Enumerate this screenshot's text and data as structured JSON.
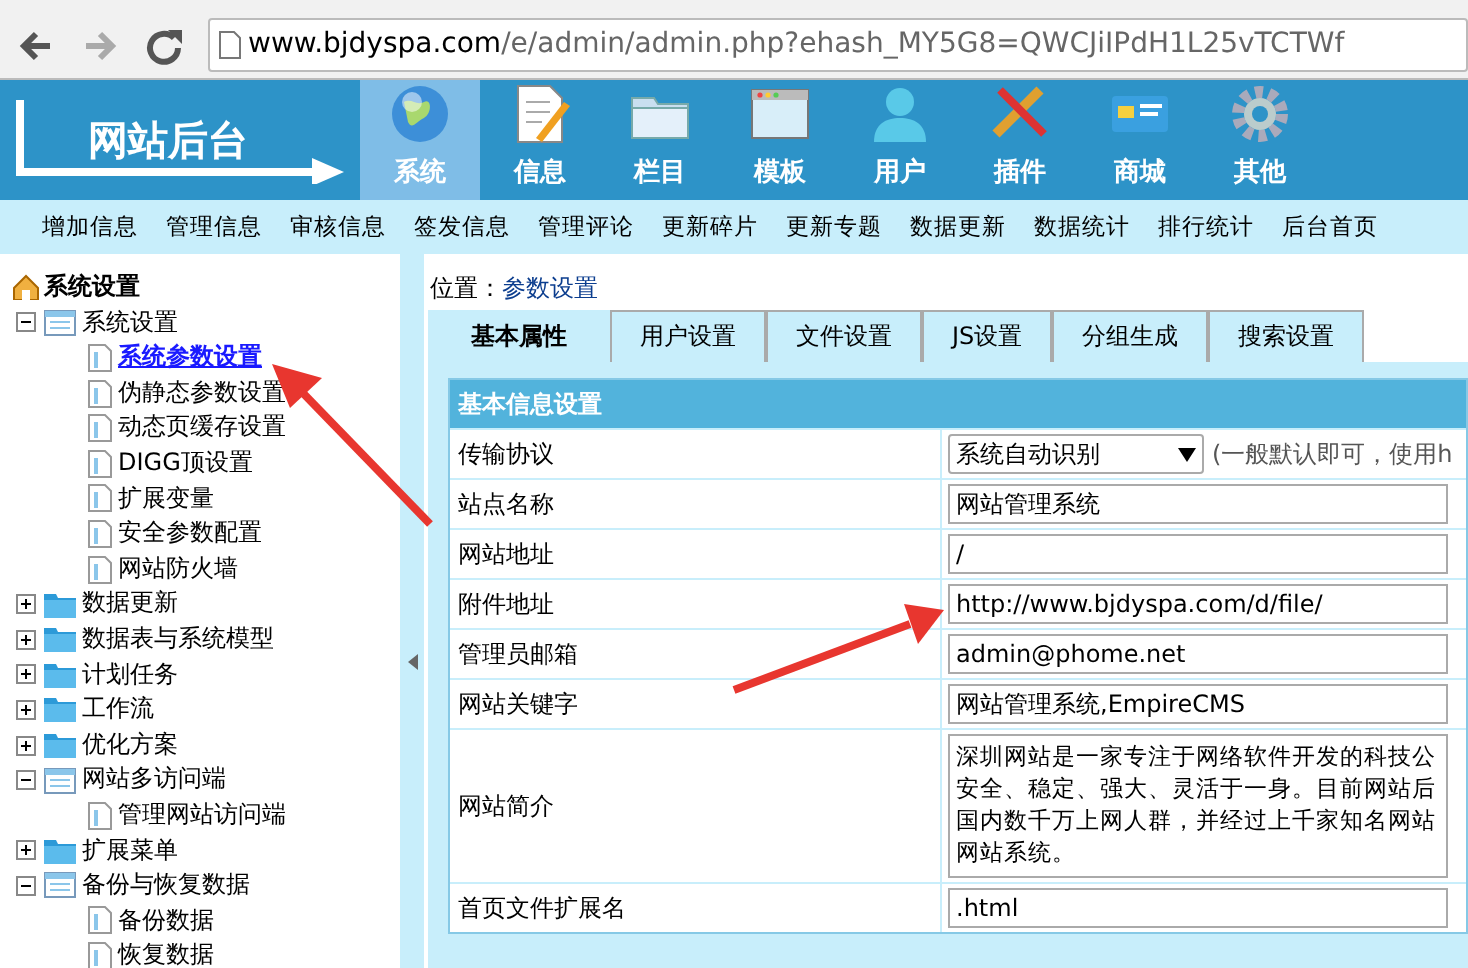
{
  "browser": {
    "url_host": "www.bjdyspa.com",
    "url_path": "/e/admin/admin.php?ehash_MY5G8=QWCJiIPdH1L25vTCTWf"
  },
  "header": {
    "logo": "网站后台",
    "nav": [
      {
        "label": "系统",
        "selected": true
      },
      {
        "label": "信息",
        "selected": false
      },
      {
        "label": "栏目",
        "selected": false
      },
      {
        "label": "模板",
        "selected": false
      },
      {
        "label": "用户",
        "selected": false
      },
      {
        "label": "插件",
        "selected": false
      },
      {
        "label": "商城",
        "selected": false
      },
      {
        "label": "其他",
        "selected": false
      }
    ]
  },
  "submenu": [
    "增加信息",
    "管理信息",
    "审核信息",
    "签发信息",
    "管理评论",
    "更新碎片",
    "更新专题",
    "数据更新",
    "数据统计",
    "排行统计",
    "后台首页"
  ],
  "sidebar": {
    "title": "系统设置",
    "items": [
      {
        "label": "系统设置",
        "expanded": true,
        "children": [
          {
            "label": "系统参数设置",
            "selected": true
          },
          {
            "label": "伪静态参数设置",
            "selected": false
          },
          {
            "label": "动态页缓存设置",
            "selected": false
          },
          {
            "label": "DIGG顶设置",
            "selected": false
          },
          {
            "label": "扩展变量",
            "selected": false
          },
          {
            "label": "安全参数配置",
            "selected": false
          },
          {
            "label": "网站防火墙",
            "selected": false
          }
        ]
      },
      {
        "label": "数据更新",
        "expanded": false
      },
      {
        "label": "数据表与系统模型",
        "expanded": false
      },
      {
        "label": "计划任务",
        "expanded": false
      },
      {
        "label": "工作流",
        "expanded": false
      },
      {
        "label": "优化方案",
        "expanded": false
      },
      {
        "label": "网站多访问端",
        "expanded": true,
        "children": [
          {
            "label": "管理网站访问端",
            "selected": false
          }
        ]
      },
      {
        "label": "扩展菜单",
        "expanded": false
      },
      {
        "label": "备份与恢复数据",
        "expanded": true,
        "children": [
          {
            "label": "备份数据",
            "selected": false
          },
          {
            "label": "恢复数据",
            "selected": false
          }
        ]
      }
    ]
  },
  "breadcrumb": {
    "label": "位置：",
    "link": "参数设置"
  },
  "tabs": [
    {
      "label": "基本属性",
      "selected": true
    },
    {
      "label": "用户设置",
      "selected": false
    },
    {
      "label": "文件设置",
      "selected": false
    },
    {
      "label": "JS设置",
      "selected": false
    },
    {
      "label": "分组生成",
      "selected": false
    },
    {
      "label": "搜索设置",
      "selected": false
    }
  ],
  "form": {
    "title": "基本信息设置",
    "rows": [
      {
        "label": "传输协议",
        "kind": "select",
        "value": "系统自动识别",
        "hint": "(一般默认即可，使用h"
      },
      {
        "label": "站点名称",
        "kind": "input",
        "value": "网站管理系统"
      },
      {
        "label": "网站地址",
        "kind": "input",
        "value": "/"
      },
      {
        "label": "附件地址",
        "kind": "input",
        "value": "http://www.bjdyspa.com/d/file/"
      },
      {
        "label": "管理员邮箱",
        "kind": "input",
        "value": "admin@phome.net"
      },
      {
        "label": "网站关键字",
        "kind": "input",
        "value": "网站管理系统,EmpireCMS"
      },
      {
        "label": "网站简介",
        "kind": "textarea",
        "lines": [
          "深圳网站是一家专注于网络软件开发的科技公",
          "安全、稳定、强大、灵活于一身。目前网站后",
          "国内数千万上网人群，并经过上千家知名网站",
          "网站系统。"
        ]
      },
      {
        "label": "首页文件扩展名",
        "kind": "input",
        "value": ".html"
      }
    ]
  }
}
